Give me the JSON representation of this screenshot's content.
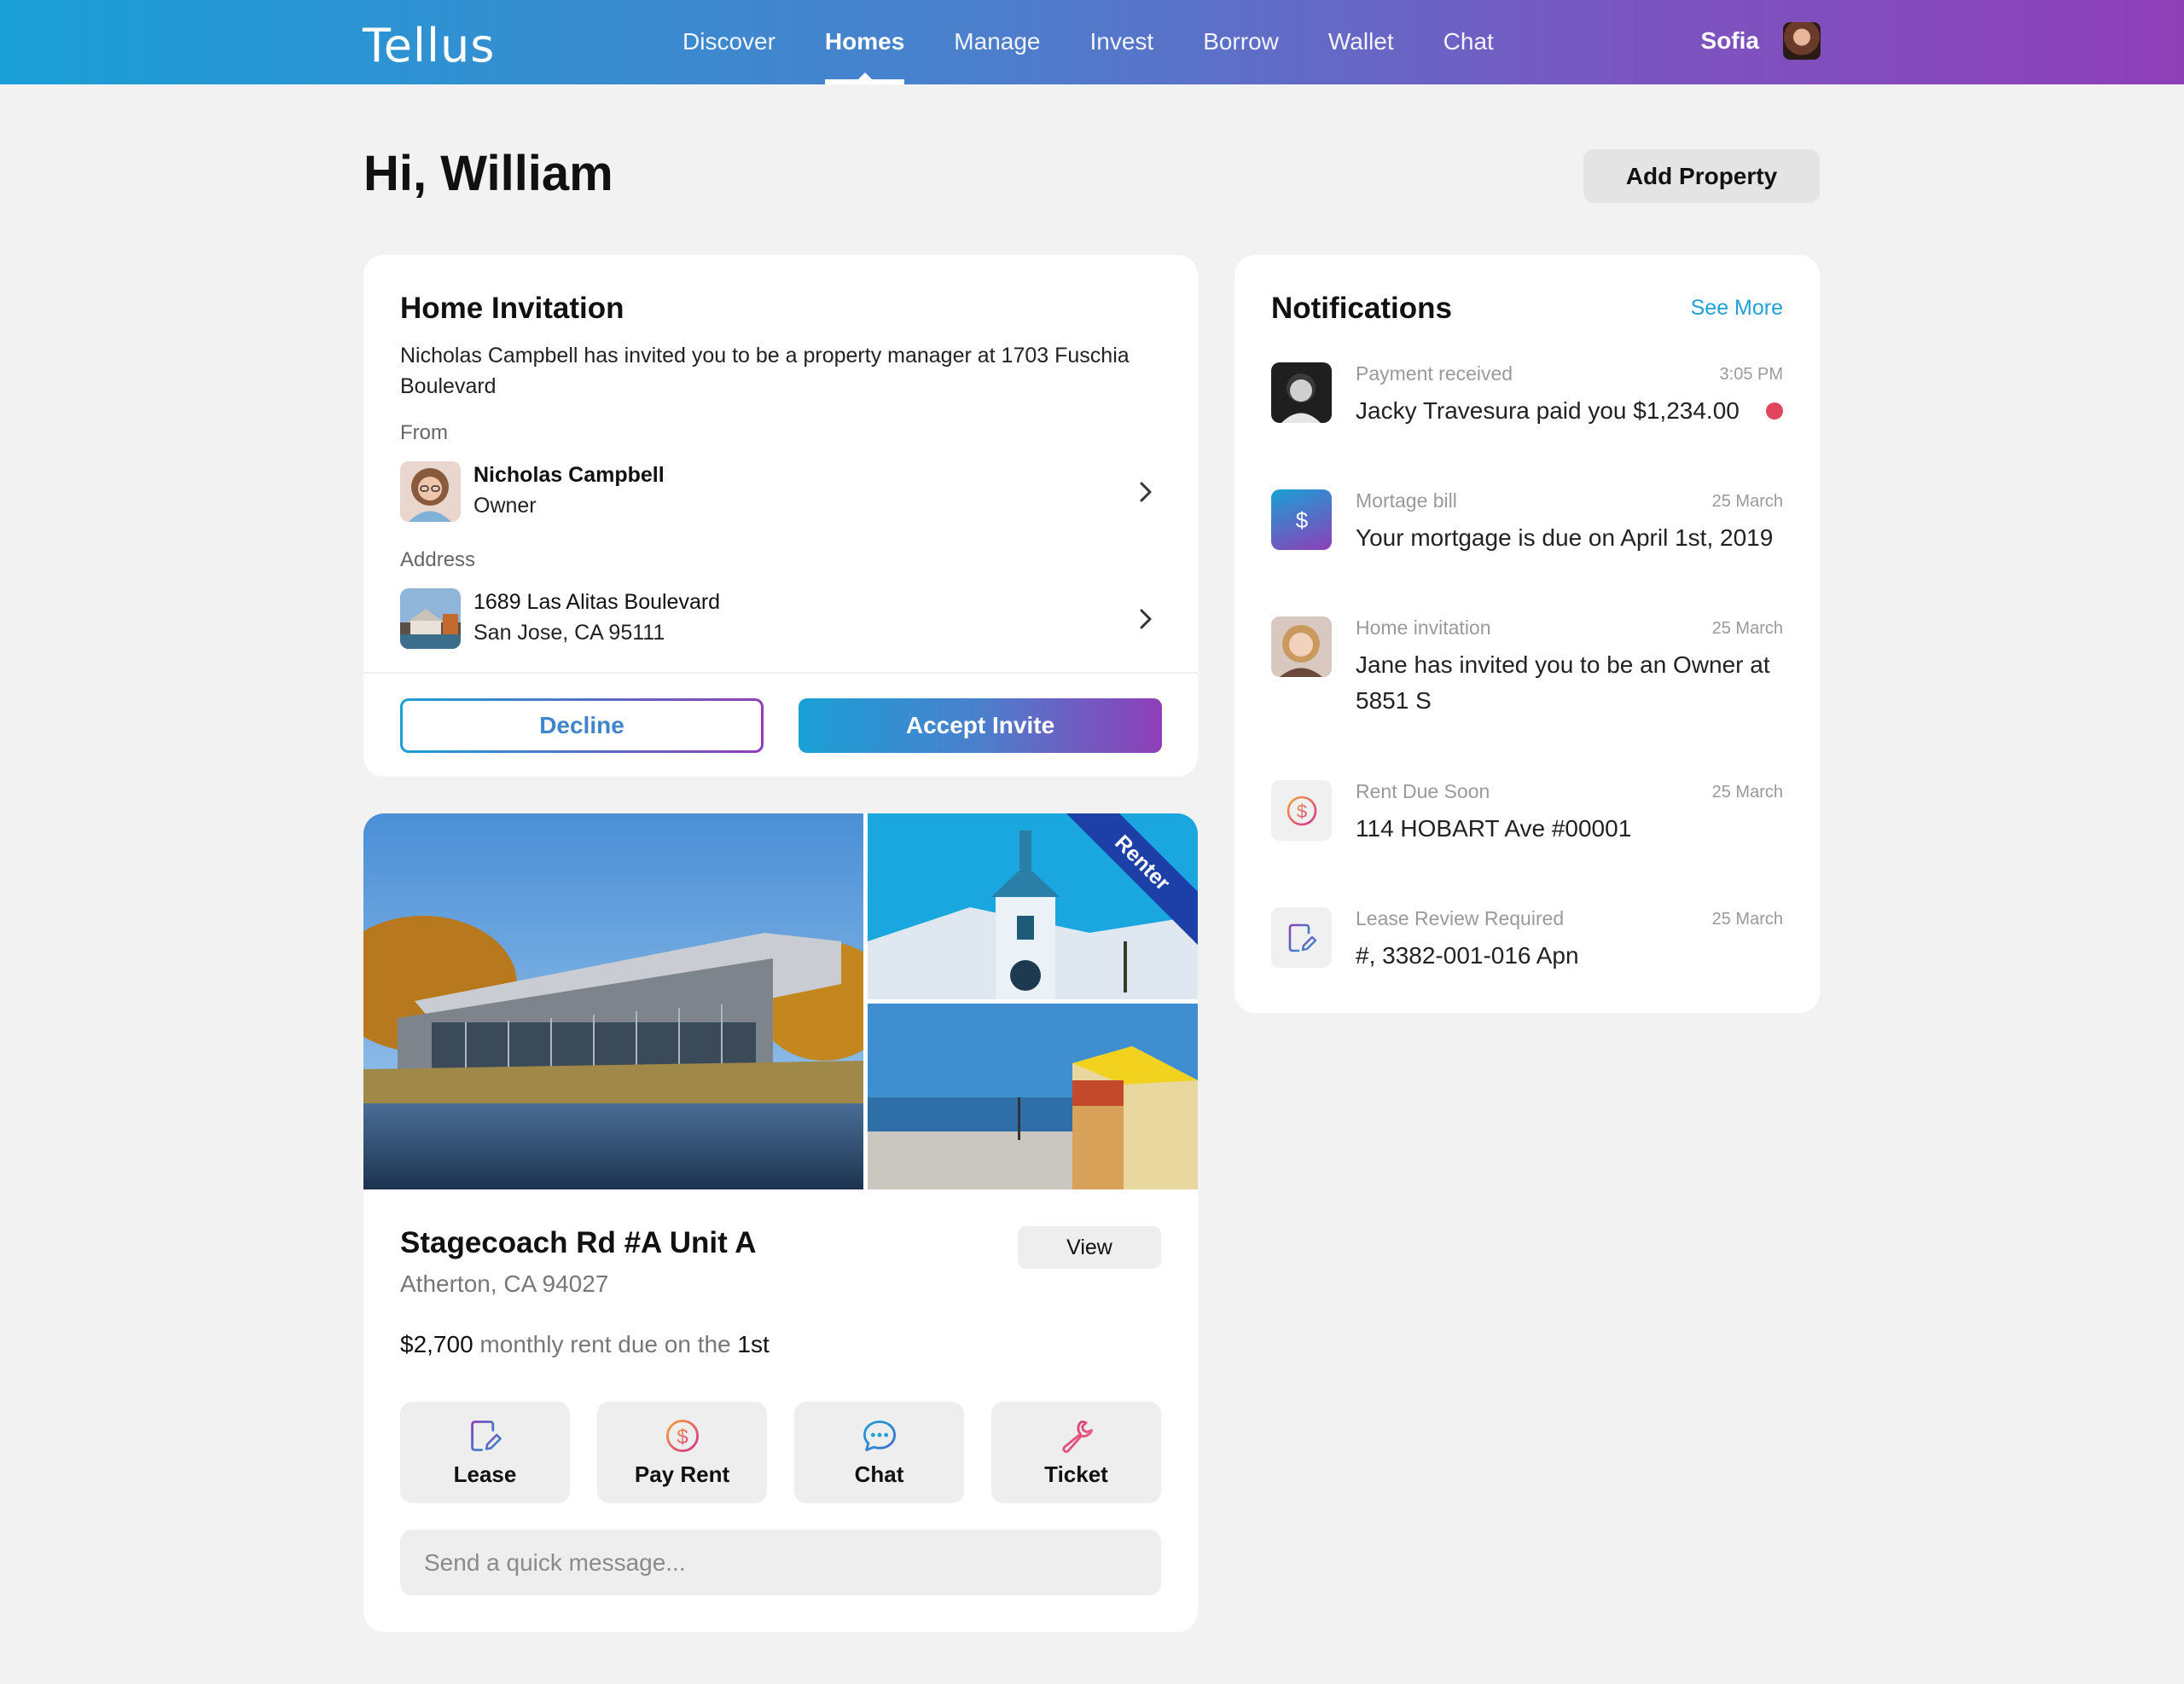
{
  "app": {
    "logo": "Tellus"
  },
  "nav": {
    "items": [
      {
        "label": "Discover"
      },
      {
        "label": "Homes"
      },
      {
        "label": "Manage"
      },
      {
        "label": "Invest"
      },
      {
        "label": "Borrow"
      },
      {
        "label": "Wallet"
      },
      {
        "label": "Chat"
      }
    ],
    "active": "Homes"
  },
  "user": {
    "name": "Sofia"
  },
  "header": {
    "greeting": "Hi, William",
    "add_property": "Add Property"
  },
  "invitation": {
    "title": "Home Invitation",
    "description": "Nicholas Campbell has invited you to be a property manager at 1703 Fuschia Boulevard",
    "from_label": "From",
    "from_name": "Nicholas Campbell",
    "from_role": "Owner",
    "address_label": "Address",
    "address_line1": "1689 Las Alitas Boulevard",
    "address_line2": "San Jose, CA 95111",
    "decline": "Decline",
    "accept": "Accept Invite"
  },
  "notifications": {
    "title": "Notifications",
    "see_more": "See More",
    "items": [
      {
        "category": "Payment received",
        "time": "3:05 PM",
        "message": "Jacky Travesura paid you $1,234.00",
        "icon": "person-avatar",
        "unread": true
      },
      {
        "category": "Mortage bill",
        "time": "25 March",
        "message": "Your mortgage is due on April 1st, 2019",
        "icon": "dollar-icon",
        "unread": false
      },
      {
        "category": "Home invitation",
        "time": "25 March",
        "message": "Jane has invited you to be an Owner at 5851 S",
        "icon": "person-avatar",
        "unread": false
      },
      {
        "category": "Rent Due Soon",
        "time": "25 March",
        "message": "114 HOBART Ave #00001",
        "icon": "dollar-circle-icon",
        "unread": false
      },
      {
        "category": "Lease Review Required",
        "time": "25 March",
        "message": "#, 3382-001-016 Apn",
        "icon": "document-edit-icon",
        "unread": false
      }
    ]
  },
  "property": {
    "badge": "Renter",
    "title": "Stagecoach Rd #A Unit A",
    "address": "Atherton, CA 94027",
    "view": "View",
    "rent_amount": "$2,700",
    "rent_text": " monthly rent due on the ",
    "rent_day": "1st",
    "actions": [
      {
        "label": "Lease",
        "icon": "document-edit-icon"
      },
      {
        "label": "Pay Rent",
        "icon": "dollar-circle-icon"
      },
      {
        "label": "Chat",
        "icon": "chat-bubble-icon"
      },
      {
        "label": "Ticket",
        "icon": "wrench-icon"
      }
    ],
    "quick_message_placeholder": "Send a quick message..."
  },
  "colors": {
    "gradient_start": "#1aa0d6",
    "gradient_end": "#8e3fb7",
    "link": "#1ea0d8",
    "unread": "#e0455c"
  }
}
